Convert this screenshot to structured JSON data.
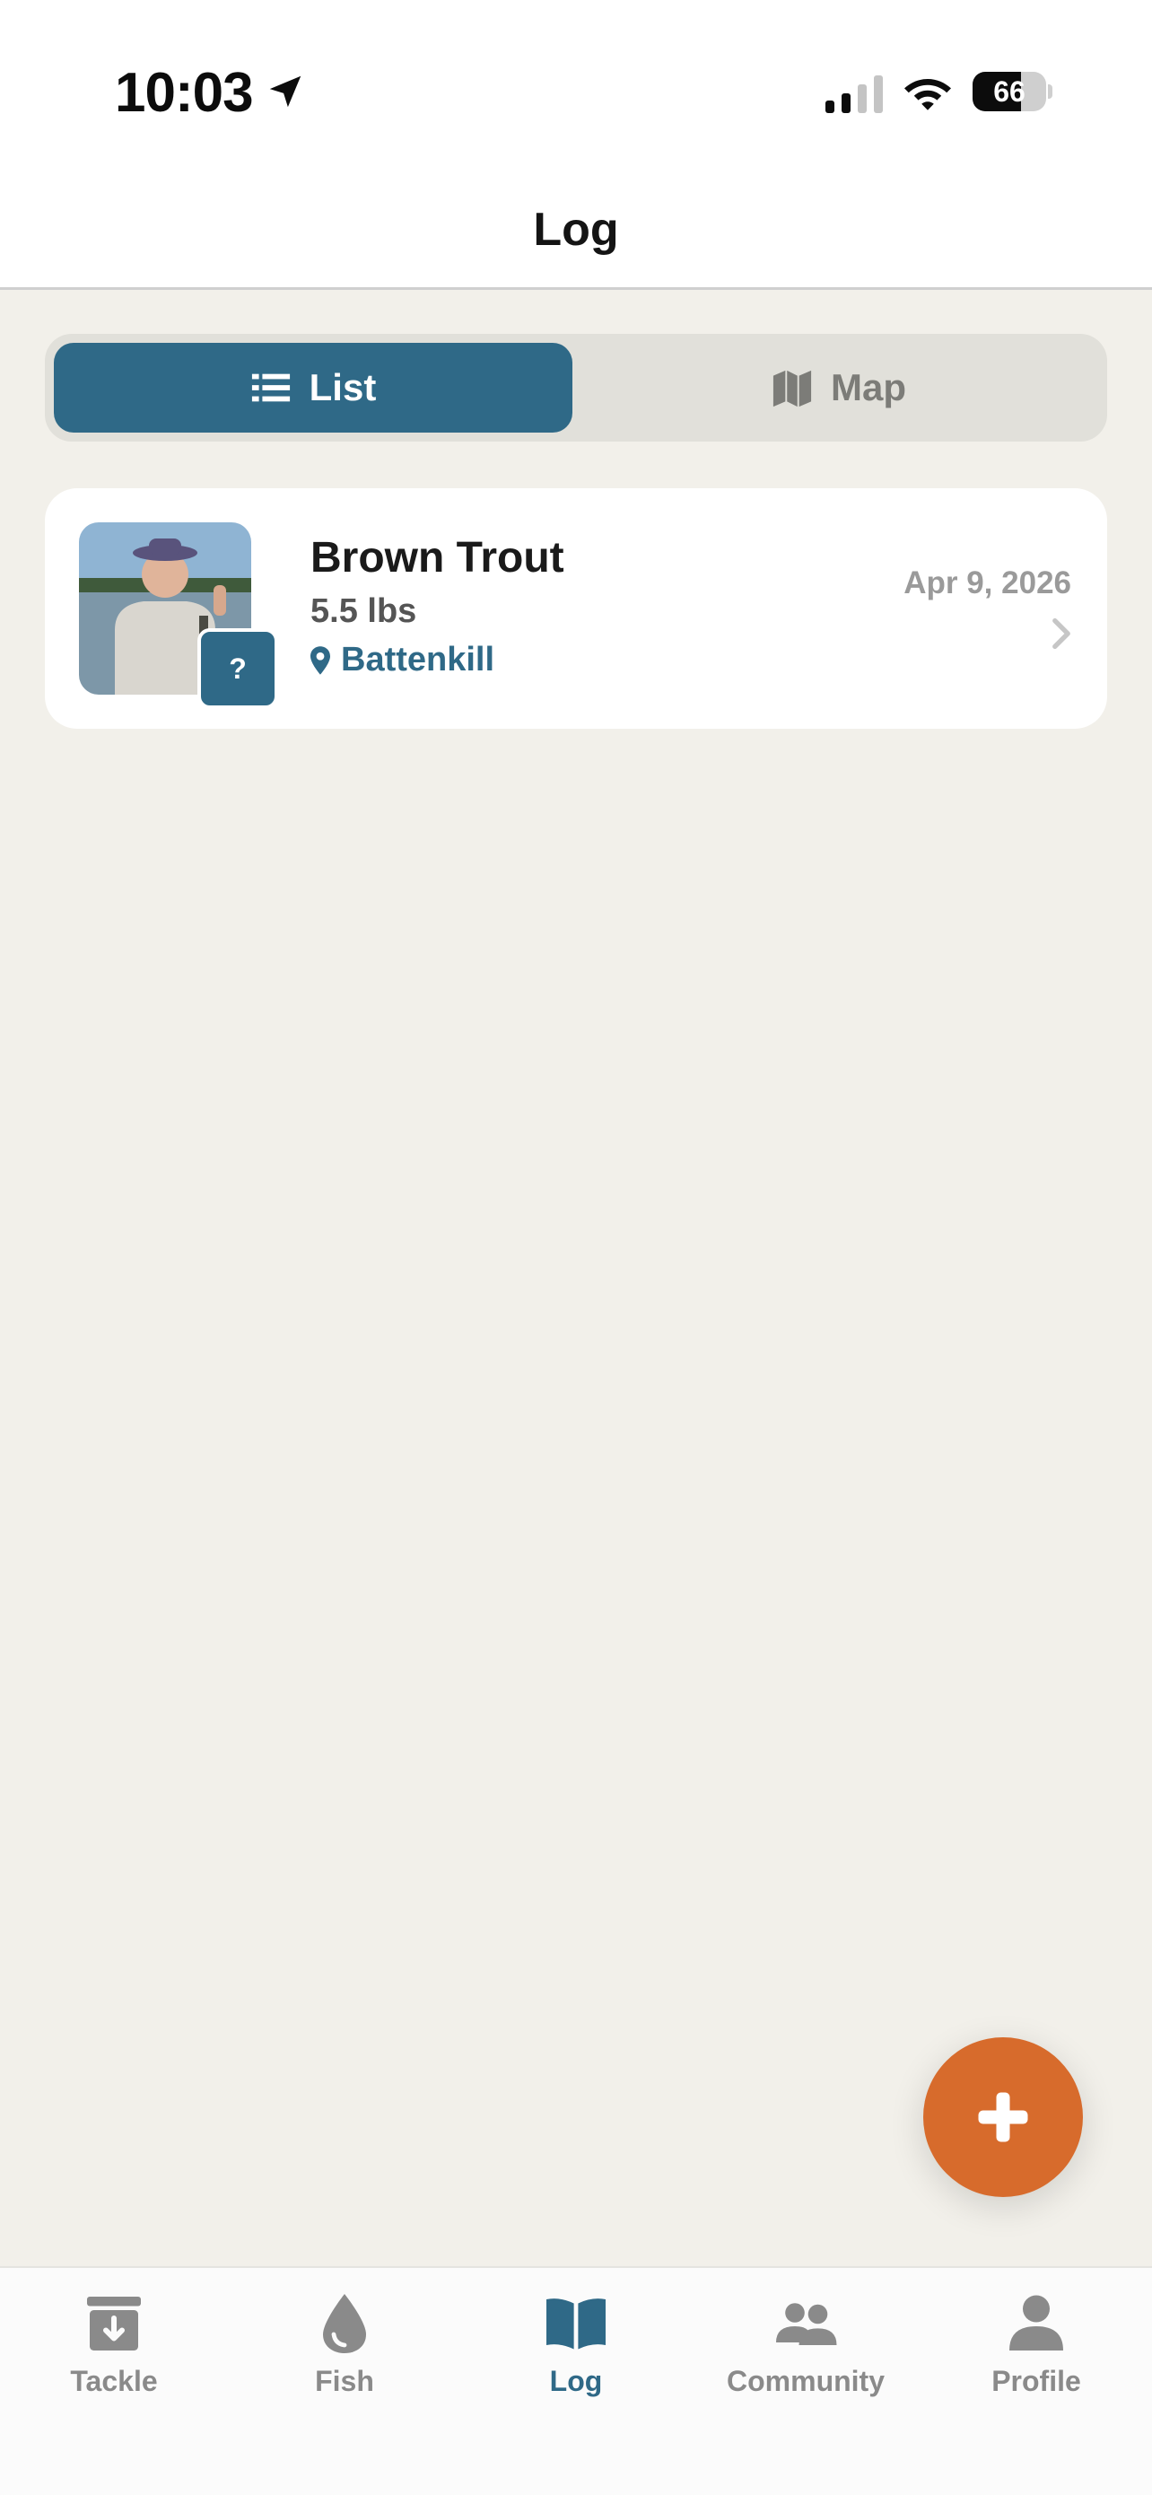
{
  "status_bar": {
    "time": "10:03",
    "battery": "66",
    "battery_level": 0.66
  },
  "header": {
    "title": "Log"
  },
  "view_toggle": {
    "options": [
      {
        "label": "List",
        "icon": "list-icon",
        "selected": true
      },
      {
        "label": "Map",
        "icon": "map-icon",
        "selected": false
      }
    ]
  },
  "entries": [
    {
      "species": "Brown Trout",
      "weight": "5.5 lbs",
      "location": "Battenkill",
      "date": "Apr 9, 2026",
      "badge": "?",
      "photo": "angler-photo"
    }
  ],
  "fab": {
    "icon": "plus-icon"
  },
  "tab_bar": {
    "tabs": [
      {
        "label": "Tackle",
        "icon": "tackle-box-icon",
        "active": false
      },
      {
        "label": "Fish",
        "icon": "water-drop-icon",
        "active": false
      },
      {
        "label": "Log",
        "icon": "open-book-icon",
        "active": true
      },
      {
        "label": "Community",
        "icon": "people-icon",
        "active": false
      },
      {
        "label": "Profile",
        "icon": "person-icon",
        "active": false
      }
    ]
  },
  "colors": {
    "accent": "#2f6987",
    "fab": "#d76b2c",
    "background": "#f2f0ea",
    "inactive": "#8a8a8a"
  }
}
